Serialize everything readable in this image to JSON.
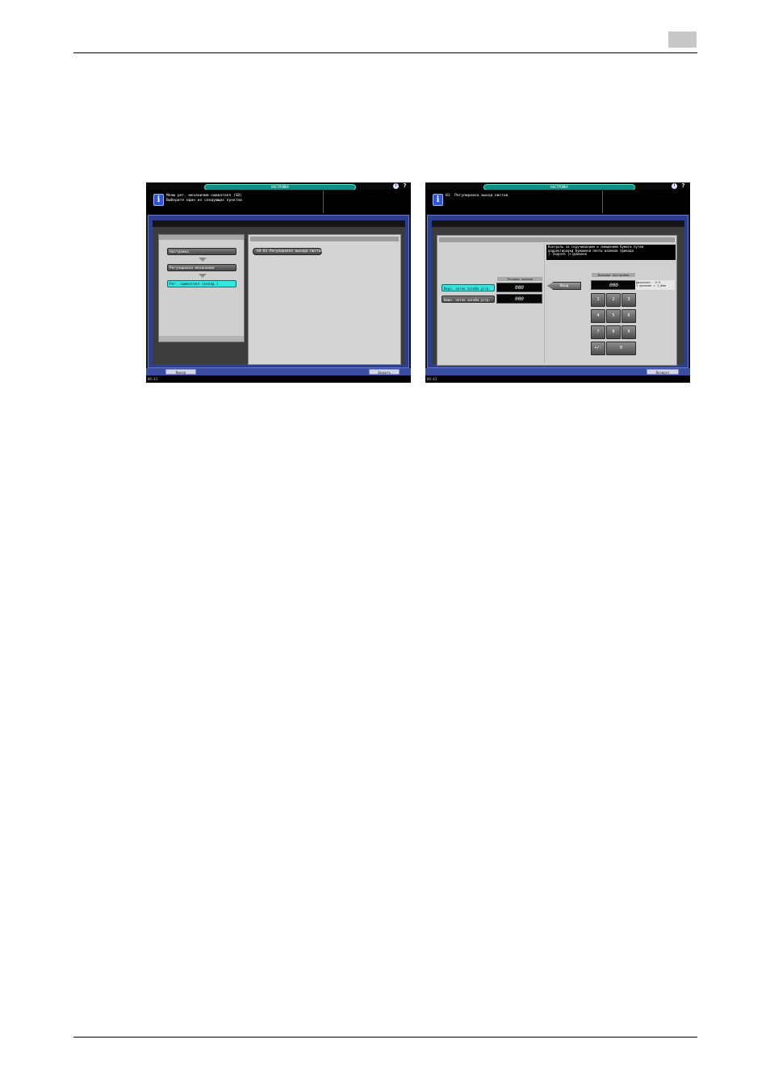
{
  "page": {
    "tab_color": "#c8c8c8"
  },
  "left_screen": {
    "title": "НАСТРОЙКА",
    "message_lines": "Меню рег. механизма-сшивателя (SD)\nВыберите один из следующих пунктов",
    "steps": [
      "Настройка",
      "Регулировка механизма",
      "Рег. сшивателя (вклад.)"
    ],
    "right_item": "SD-01  Регулировка выхода листов",
    "exit_label": "Выход",
    "close_label": "Закрыть",
    "status_time": "09:43"
  },
  "right_screen": {
    "title": "НАСТРОЙКА",
    "message": "01  Регулировка выход листов",
    "note": "Контроль за скручиванием и смещением бумаги путем\nкорректировки бумажной ленты валиков привода\n[-]короче [+]длиннее",
    "current_header": "Текущие данные",
    "input_header": "Входные настройки",
    "items": [
      {
        "label": "Верх. лоток загиба устр.",
        "value": "000"
      },
      {
        "label": "Нижн. лоток загиба устр.",
        "value": "000"
      }
    ],
    "set_label": "Ввод",
    "input_value": "000",
    "range_text": "Диапазон: -5~5\n1 деление = 1,0мм",
    "keys": [
      "1",
      "2",
      "3",
      "4",
      "5",
      "6",
      "7",
      "8",
      "9",
      "+/-",
      "0"
    ],
    "return_label": "Возврат",
    "status_time": "09:43"
  },
  "colors": {
    "accent_cyan": "#34e6e0",
    "frame_blue": "#2f3e8c",
    "title_teal": "#0d8f86"
  }
}
